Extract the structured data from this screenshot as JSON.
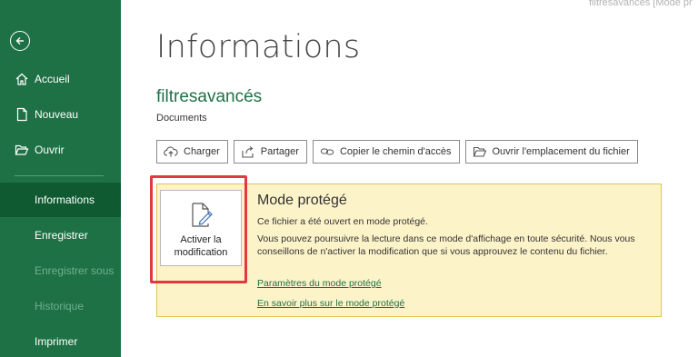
{
  "titlebar": {
    "text": "filtresavancés  [Mode pr"
  },
  "sidebar": {
    "back_label": "",
    "items": [
      {
        "label": "Accueil"
      },
      {
        "label": "Nouveau"
      },
      {
        "label": "Ouvrir"
      },
      {
        "label": "Informations"
      },
      {
        "label": "Enregistrer"
      },
      {
        "label": "Enregistrer sous"
      },
      {
        "label": "Historique"
      },
      {
        "label": "Imprimer"
      }
    ]
  },
  "main": {
    "title": "Informations",
    "file_name": "filtresavancés",
    "file_location": "Documents",
    "actions": [
      {
        "label": "Charger",
        "icon": "upload-cloud-icon"
      },
      {
        "label": "Partager",
        "icon": "share-icon"
      },
      {
        "label": "Copier le chemin d'accès",
        "icon": "link-icon"
      },
      {
        "label": "Ouvrir l'emplacement du fichier",
        "icon": "folder-open-icon"
      }
    ]
  },
  "protected_mode": {
    "enable_button_line1": "Activer la",
    "enable_button_line2": "modification",
    "title": "Mode protégé",
    "line1": "Ce fichier a été ouvert en mode protégé.",
    "line2": "Vous pouvez poursuivre la lecture dans ce mode d'affichage en toute sécurité. Nous vous conseillons de n'activer la modification que si vous approuvez le contenu du fichier.",
    "link1": "Paramètres du mode protégé",
    "link2": "En savoir plus sur le mode protégé"
  },
  "colors": {
    "brand": "#1e7145",
    "active_nav": "#0f5a31",
    "panel_bg": "#fdf3c9",
    "highlight": "#e0393e"
  }
}
